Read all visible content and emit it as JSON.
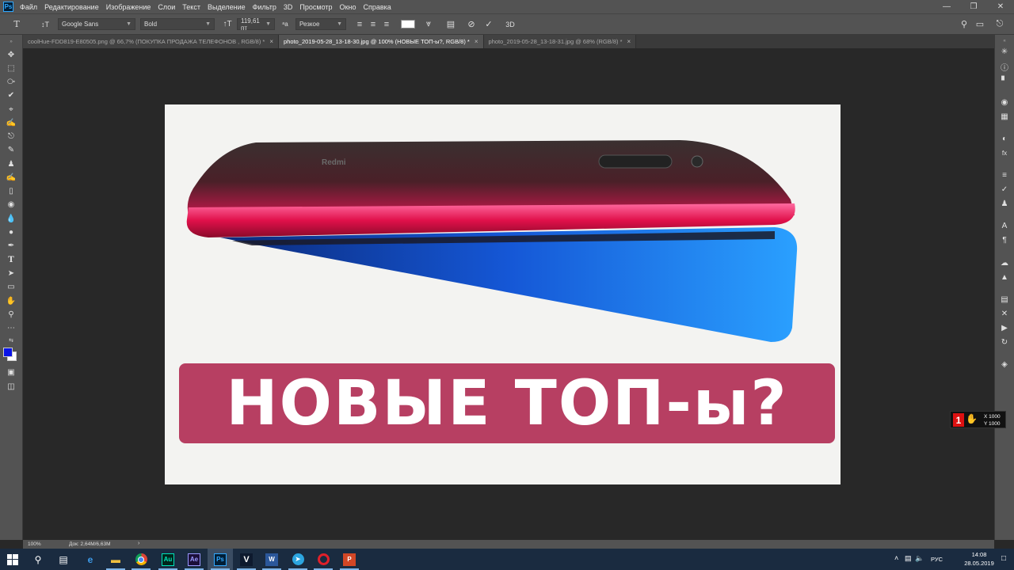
{
  "app": {
    "logo": "Ps"
  },
  "menu": [
    "Файл",
    "Редактирование",
    "Изображение",
    "Слои",
    "Текст",
    "Выделение",
    "Фильтр",
    "3D",
    "Просмотр",
    "Окно",
    "Справка"
  ],
  "options": {
    "tool_icon": "type-tool-icon",
    "font_family": "Google Sans",
    "font_style": "Bold",
    "font_size": "119,61 пт",
    "antialias": "Резкое",
    "color_swatch": "#ffffff",
    "label_3d": "3D"
  },
  "tabs": [
    {
      "label": "coolHue-FDD819-E80505.png @ 66,7% (ПОКУПКА  ПРОДАЖА   ТЕЛЕФОНОВ , RGB/8) *",
      "active": false
    },
    {
      "label": "photo_2019-05-28_13-18-30.jpg @ 100% (НОВЫЕ ТОП-ы?, RGB/8) *",
      "active": true
    },
    {
      "label": "photo_2019-05-28_13-18-31.jpg @ 68% (RGB/8) *",
      "active": false
    }
  ],
  "canvas": {
    "banner_text": "НОВЫЕ ТОП-ы?",
    "banner_color": "#b73f62",
    "brand_text": "Redmi"
  },
  "colors": {
    "foreground": "#0a14e6",
    "background": "#ffffff"
  },
  "status": {
    "zoom": "100%",
    "doc_size": "Док: 2,64M/6,63M"
  },
  "overlay": {
    "number": "1",
    "x_label": "X 1000",
    "y_label": "Y 1000"
  },
  "taskbar": {
    "apps": [
      {
        "name": "Audition",
        "abbr": "Au"
      },
      {
        "name": "After Effects",
        "abbr": "Ae"
      },
      {
        "name": "Photoshop",
        "abbr": "Ps"
      },
      {
        "name": "Vegas",
        "abbr": "V"
      },
      {
        "name": "Word",
        "abbr": "W"
      },
      {
        "name": "PowerPoint",
        "abbr": "P"
      }
    ],
    "language": "РУС",
    "time": "14:08",
    "date": "28.05.2019"
  }
}
